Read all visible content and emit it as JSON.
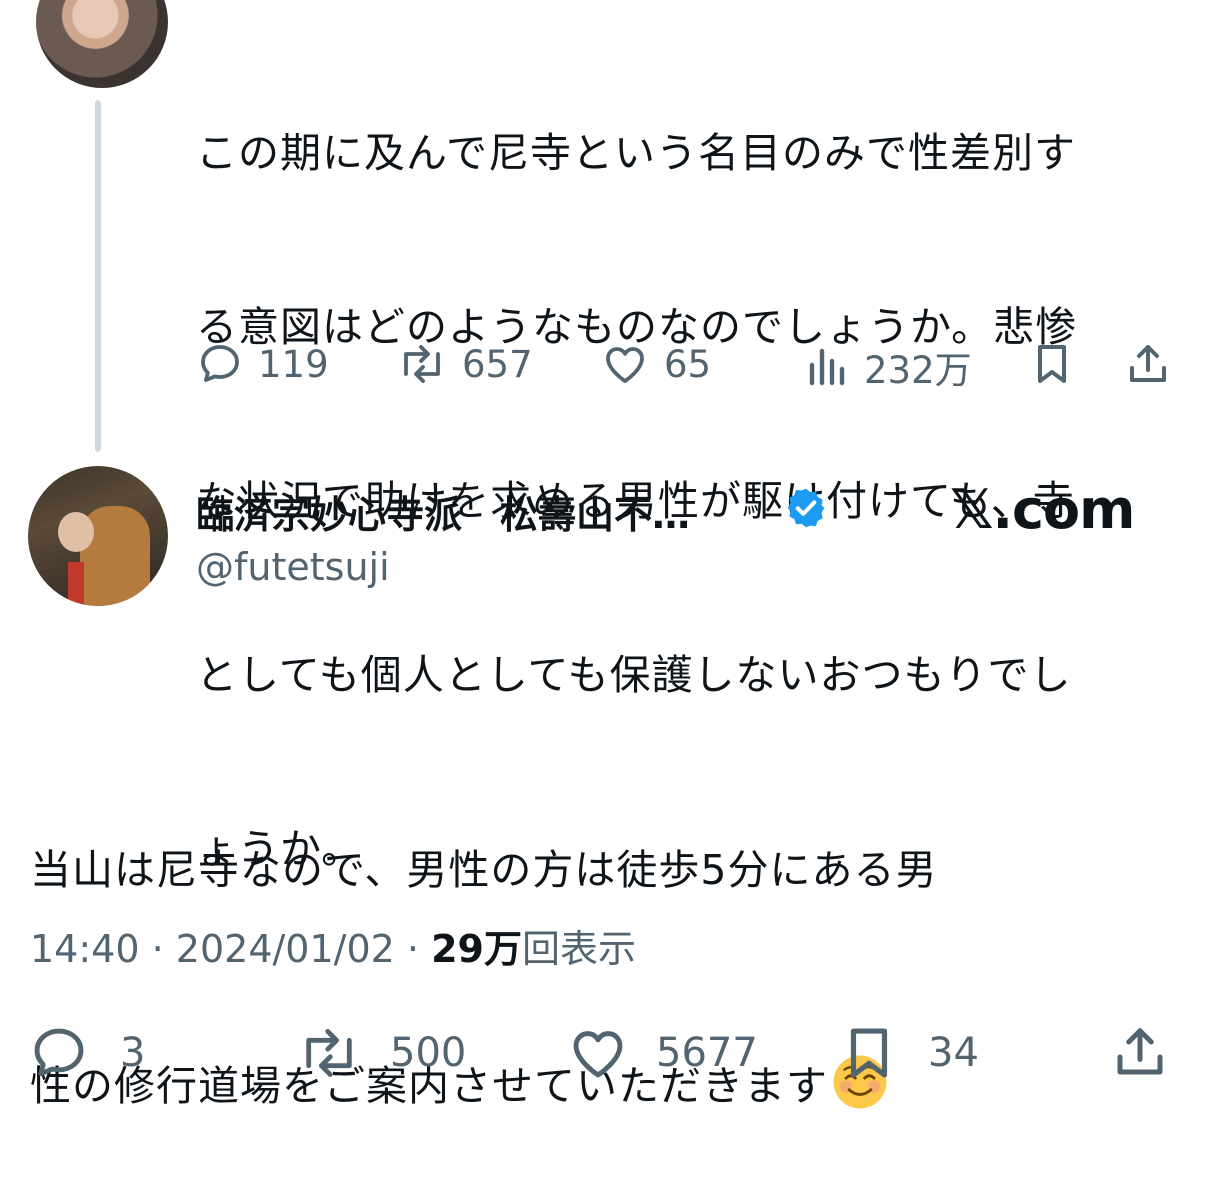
{
  "parent_tweet": {
    "text_lines": [
      "この期に及んで尼寺という名目のみで性差別す",
      "る意図はどのようなものなのでしょうか。悲惨",
      "な状況で助けを求める男性が駆け付けても、寺",
      "としても個人としても保護しないおつもりでし",
      "ょうか。"
    ],
    "actions": {
      "replies": "119",
      "reposts": "657",
      "likes": "65",
      "views": "232万"
    }
  },
  "main_tweet": {
    "display_name": "臨済宗妙心寺派　松壽山不…",
    "handle": "@futetsuji",
    "watermark": "𝕏.com",
    "text_lines": [
      "当山は尼寺なので、男性の方は徒歩5分にある男",
      "性の修行道場をご案内させていただきます"
    ],
    "time": "14:40",
    "date": "2024/01/02",
    "separator": "·",
    "views_count": "29万",
    "views_label": "回表示",
    "actions": {
      "replies": "3",
      "reposts": "500",
      "likes": "5677",
      "bookmarks": "34"
    }
  },
  "colors": {
    "text": "#0f1419",
    "secondary": "#536471",
    "verified": "#1d9bf0",
    "thread_line": "#cfd9de"
  }
}
